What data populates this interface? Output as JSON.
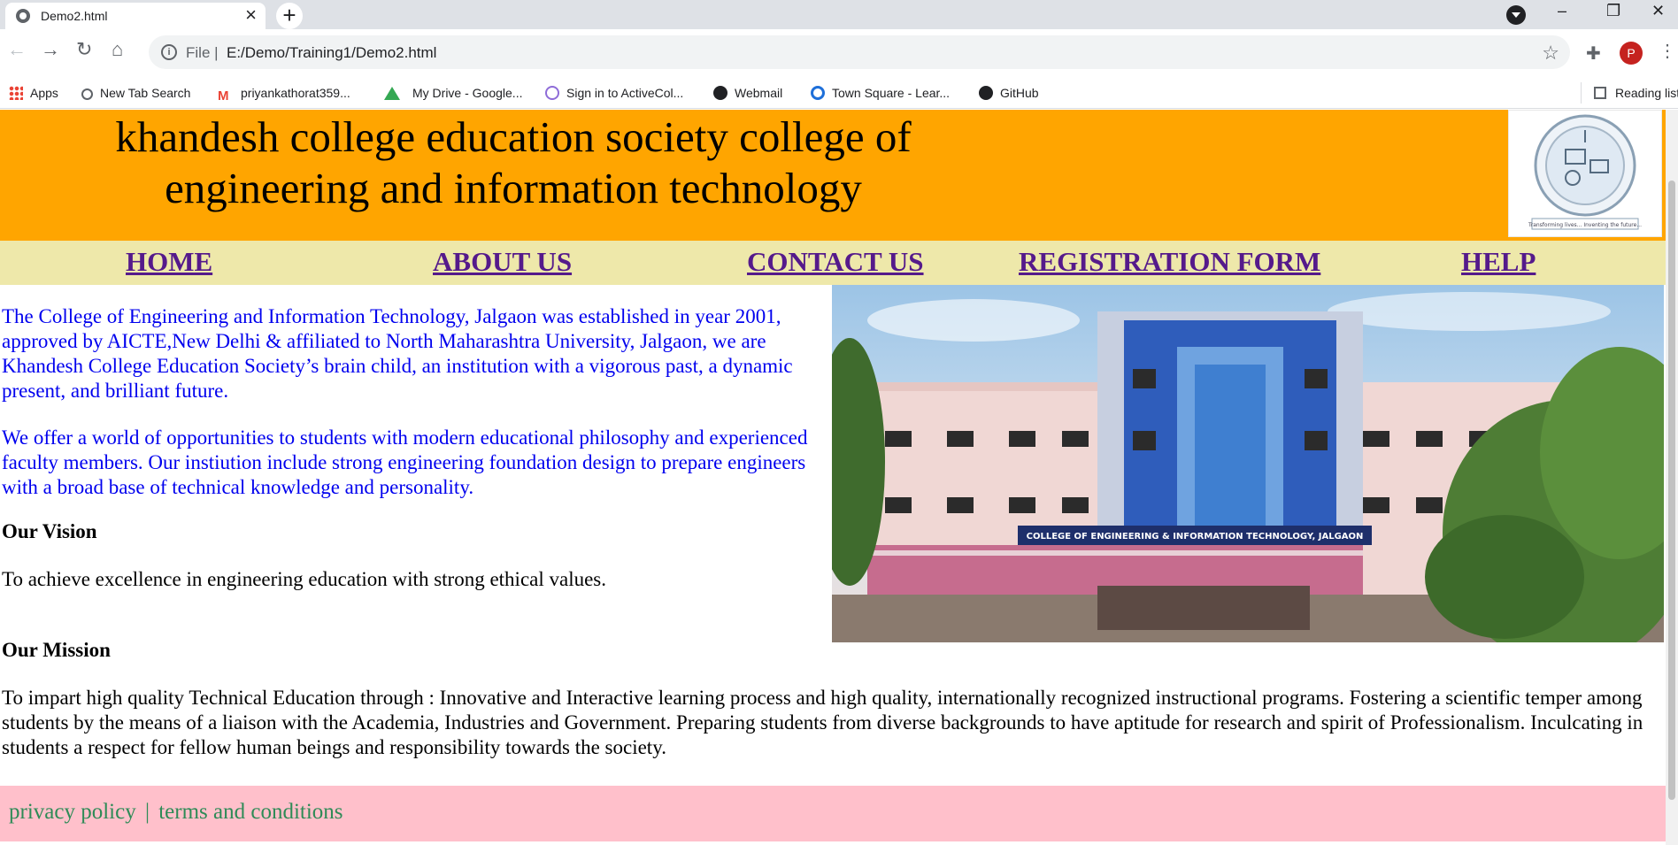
{
  "browser": {
    "tab_title": "Demo2.html",
    "scheme_label": "File",
    "url": "E:/Demo/Training1/Demo2.html",
    "profile_initial": "P",
    "bookmarks": [
      {
        "label": "Apps",
        "icon": "apps-grid-icon"
      },
      {
        "label": "New Tab Search",
        "icon": "search-icon"
      },
      {
        "label": "priyankathorat359...",
        "icon": "gmail-icon"
      },
      {
        "label": "My Drive - Google...",
        "icon": "google-drive-icon"
      },
      {
        "label": "Sign in to ActiveCol...",
        "icon": "activecollab-icon"
      },
      {
        "label": "Webmail",
        "icon": "webmail-icon"
      },
      {
        "label": "Town Square - Lear...",
        "icon": "town-square-icon"
      },
      {
        "label": "GitHub",
        "icon": "github-icon"
      }
    ],
    "reading_list": "Reading list"
  },
  "page": {
    "header_title": "khandesh college education society college of engineering and information technology",
    "nav": [
      "HOME",
      "ABOUT US",
      "CONTACT US",
      "REGISTRATION FORM",
      "HELP"
    ],
    "intro": [
      "The College of Engineering and Information Technology, Jalgaon was established in year 2001, approved by AICTE,New Delhi & affiliated to North Maharashtra University, Jalgaon, we are Khandesh College Education Society’s brain child, an institution with a vigorous past, a dynamic present, and brilliant future.",
      "We offer a world of opportunities to students with modern educational philosophy and experienced faculty members. Our instiution include strong engineering foundation design to prepare engineers with a broad base of technical knowledge and personality."
    ],
    "vision_heading": "Our Vision",
    "vision_text": "To achieve excellence in engineering education with strong ethical values.",
    "mission_heading": "Our Mission",
    "mission_text": "To impart high quality Technical Education through : Innovative and Interactive learning process and high quality, internationally recognized instructional programs. Fostering a scientific temper among students by the means of a liaison with the Academia, Industries and Government. Preparing students from diverse backgrounds to have aptitude for research and spirit of Professionalism. Inculcating in students a respect for fellow human beings and responsibility towards the society.",
    "campus_banner": "COLLEGE OF ENGINEERING & INFORMATION TECHNOLOGY, JALGAON",
    "logo_tagline": "Transforming lives... Inventing the future...",
    "footer_links": [
      "privacy policy",
      "terms and conditions"
    ],
    "footer_separator": "|"
  },
  "colors": {
    "header_bg": "#ffa500",
    "nav_bg": "#eee8aa",
    "nav_link": "#551a8b",
    "intro_text": "#0000ee",
    "footer_bg": "#ffc0cb",
    "footer_link": "#2e8b57"
  }
}
